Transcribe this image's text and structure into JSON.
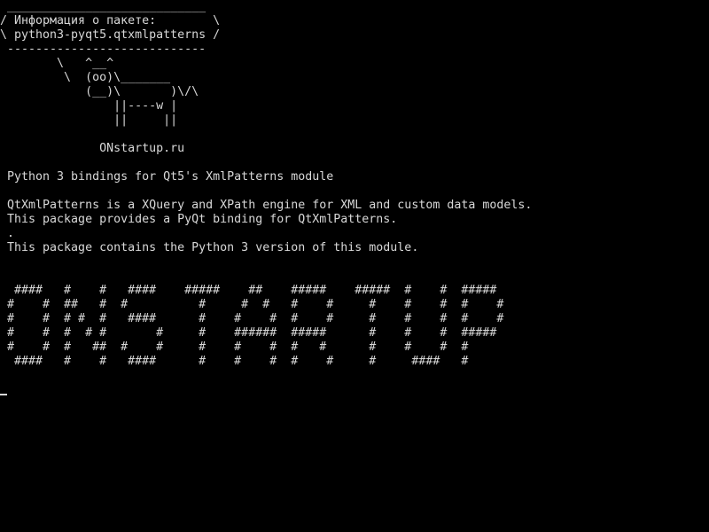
{
  "terminal": {
    "lines": [
      " ____________________________",
      "/ Информация о пакете:        \\",
      "\\ python3-pyqt5.qtxmlpatterns /",
      " ----------------------------",
      "        \\   ^__^",
      "         \\  (oo)\\_______",
      "            (__)\\       )\\/\\",
      "                ||----w |",
      "                ||     ||",
      "",
      "              ONstartup.ru",
      "",
      " Python 3 bindings for Qt5's XmlPatterns module",
      "",
      " QtXmlPatterns is a XQuery and XPath engine for XML and custom data models.",
      " This package provides a PyQt binding for QtXmlPatterns.",
      " .",
      " This package contains the Python 3 version of this module.",
      "",
      "",
      "  ####   #    #   ####    #####    ##    #####    #####  #    #  #####",
      " #    #  ##   #  #          #     #  #   #    #     #    #    #  #    #",
      " #    #  # #  #   ####      #    #    #  #    #     #    #    #  #    #",
      " #    #  #  # #       #     #    ######  #####      #    #    #  #####",
      " #    #  #   ##  #    #     #    #    #  #   #      #    #    #  #",
      "  ####   #    #   ####      #    #    #  #    #     #     ####   #"
    ]
  }
}
